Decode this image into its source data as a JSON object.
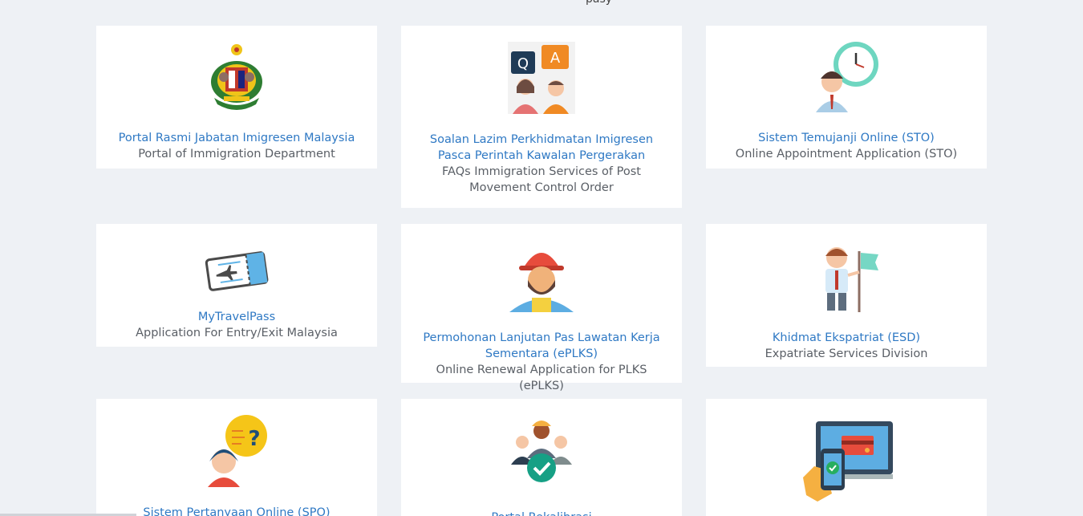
{
  "header": {
    "cut_text": "pasy"
  },
  "cards": [
    {
      "icon": "immigration-crest-icon",
      "title": "Portal Rasmi Jabatan Imigresen Malaysia",
      "subtitle": "Portal of Immigration Department"
    },
    {
      "icon": "qa-faq-icon",
      "title": "Soalan Lazim Perkhidmatan Imigresen Pasca Perintah Kawalan Pergerakan",
      "subtitle": "FAQs Immigration Services of Post Movement Control Order"
    },
    {
      "icon": "appointment-clock-icon",
      "title": "Sistem Temujanji Online (STO)",
      "subtitle": "Online Appointment Application (STO)"
    },
    {
      "icon": "travel-ticket-icon",
      "title": "MyTravelPass",
      "subtitle": "Application For Entry/Exit Malaysia"
    },
    {
      "icon": "worker-helmet-icon",
      "title": "Permohonan Lanjutan Pas Lawatan Kerja Sementara (ePLKS)",
      "subtitle": "Online Renewal Application for PLKS (ePLKS)"
    },
    {
      "icon": "expatriate-flag-icon",
      "title": "Khidmat Ekspatriat (ESD)",
      "subtitle": "Expatriate Services Division"
    },
    {
      "icon": "question-person-icon",
      "title": "Sistem Pertanyaan Online (SPO)",
      "subtitle": ""
    },
    {
      "icon": "verified-workers-icon",
      "title": "Portal Rekalibrasi",
      "subtitle": ""
    },
    {
      "icon": "online-payment-icon",
      "title": "",
      "subtitle": ""
    }
  ]
}
